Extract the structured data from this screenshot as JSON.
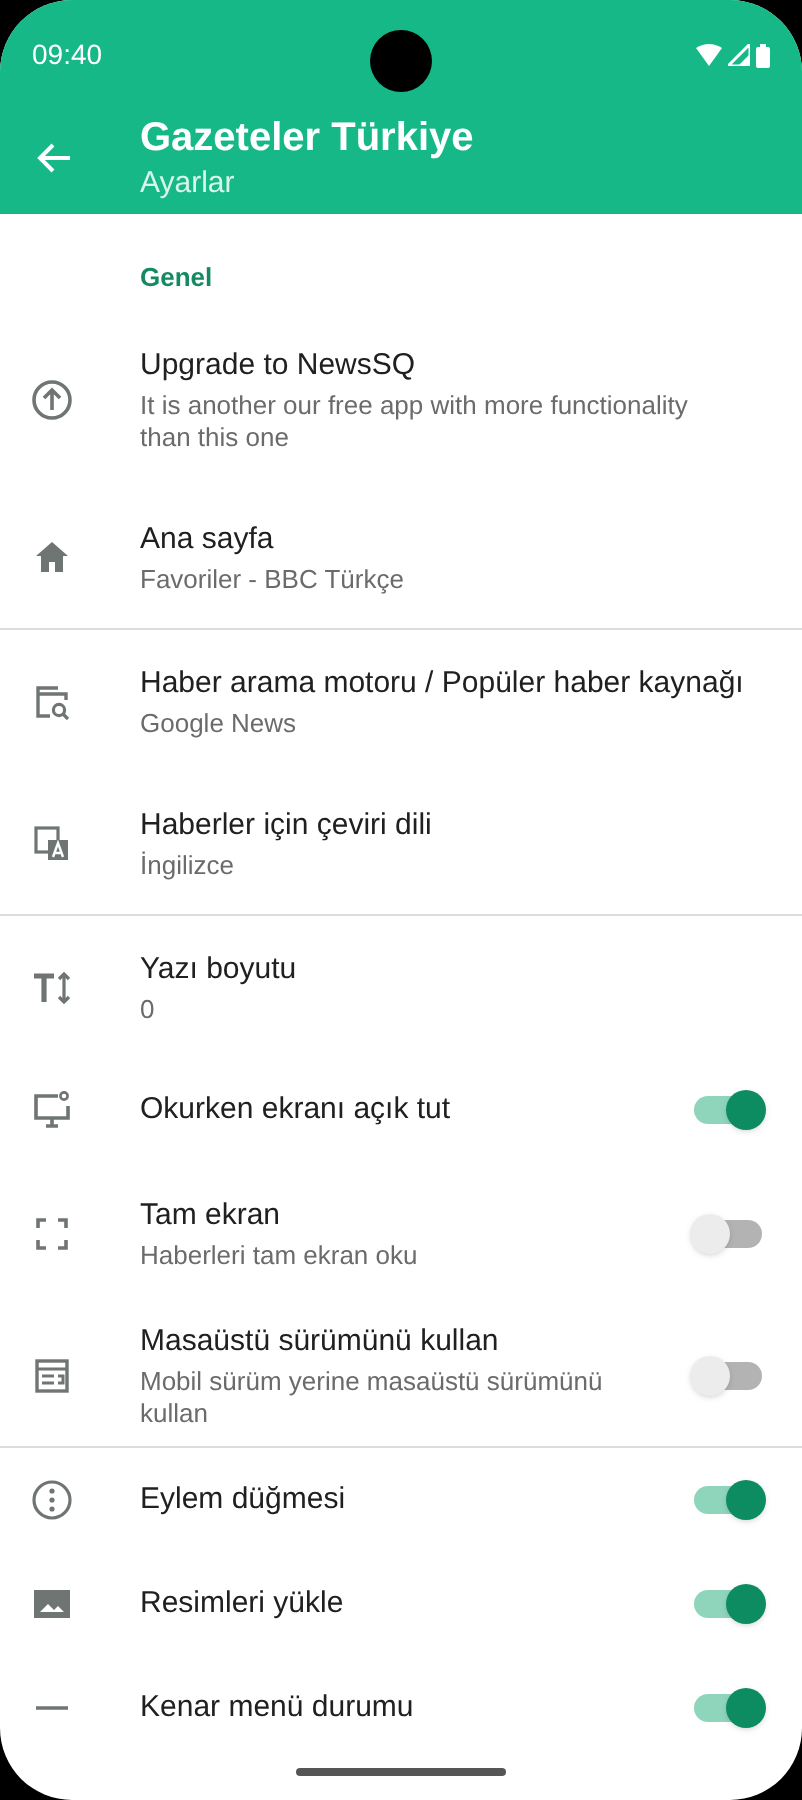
{
  "status_bar": {
    "time": "09:40"
  },
  "app_bar": {
    "title": "Gazeteler Türkiye",
    "subtitle": "Ayarlar"
  },
  "sections": [
    {
      "header": "Genel",
      "items": [
        {
          "kind": "pref",
          "title": "Upgrade to NewsSQ",
          "summary": "It is another our free app with more functionality than this one"
        },
        {
          "kind": "pref",
          "title": "Ana sayfa",
          "summary": "Favoriler - BBC Türkçe"
        }
      ]
    },
    {
      "items": [
        {
          "kind": "pref",
          "title": "Haber arama motoru / Popüler haber kaynağı",
          "summary": "Google News"
        },
        {
          "kind": "pref",
          "title": "Haberler için çeviri dili",
          "summary": "İngilizce"
        }
      ]
    },
    {
      "items": [
        {
          "kind": "pref",
          "title": "Yazı boyutu",
          "summary": "0"
        },
        {
          "kind": "switch",
          "title": "Okurken ekranı açık tut",
          "on": true
        },
        {
          "kind": "switch",
          "title": "Tam ekran",
          "summary": "Haberleri tam ekran oku",
          "on": false
        },
        {
          "kind": "switch",
          "title": "Masaüstü sürümünü kullan",
          "summary": "Mobil sürüm yerine masaüstü sürümünü kullan",
          "on": false
        }
      ]
    },
    {
      "items": [
        {
          "kind": "switch",
          "title": "Eylem düğmesi",
          "on": true
        },
        {
          "kind": "switch",
          "title": "Resimleri yükle",
          "on": true
        },
        {
          "kind": "switch",
          "title": "Kenar menü durumu",
          "on": true
        }
      ]
    }
  ]
}
